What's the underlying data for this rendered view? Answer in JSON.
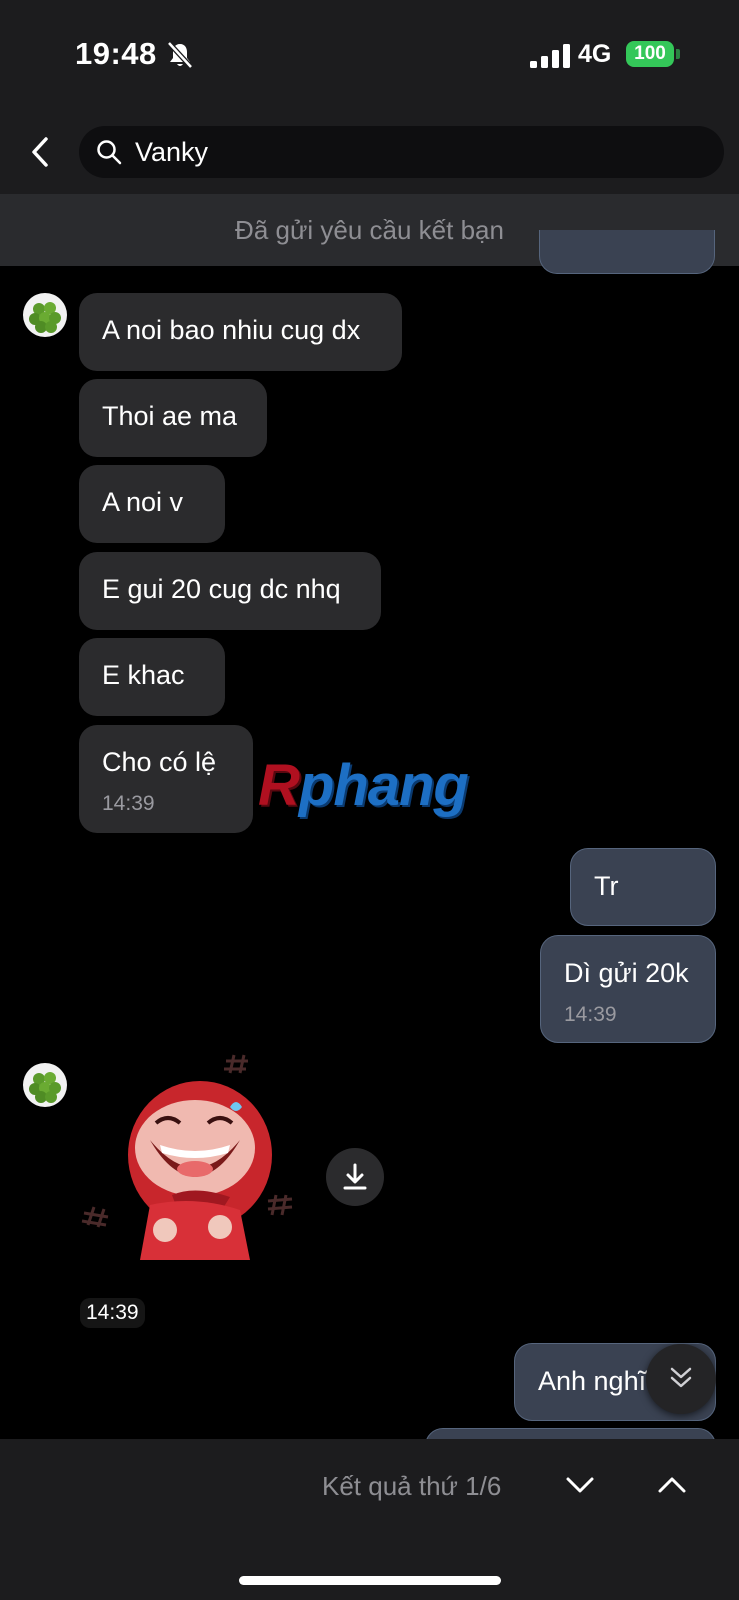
{
  "status": {
    "time": "19:48",
    "network": "4G",
    "battery": "100"
  },
  "search": {
    "query": "Vanky"
  },
  "notice": "Đã gửi yêu cầu kết bạn",
  "messages": [
    {
      "text": "A noi bao nhiu cug dx"
    },
    {
      "text": "Thoi ae ma"
    },
    {
      "text": "A noi v"
    },
    {
      "text": "E gui 20 cug dc nhq"
    },
    {
      "text": "E khac"
    },
    {
      "text": "Cho có lệ",
      "time": "14:39"
    },
    {
      "text": "Tr"
    },
    {
      "text": "Dì gửi 20k",
      "time": "14:39"
    },
    {
      "text": "Anh nghĩ"
    }
  ],
  "sticker": {
    "time": "14:39"
  },
  "watermark": {
    "r": "R",
    "rest": "phang"
  },
  "footer": {
    "result": "Kết quả thứ 1/6"
  },
  "colors": {
    "incoming_bubble": "#2b2b2d",
    "outgoing_bubble": "#3a4252",
    "battery": "#34c759"
  },
  "icons": [
    "bell-slash-icon",
    "signal-icon",
    "back-icon",
    "search-icon",
    "download-icon",
    "double-chevron-down-icon",
    "chevron-down-icon",
    "chevron-up-icon"
  ]
}
